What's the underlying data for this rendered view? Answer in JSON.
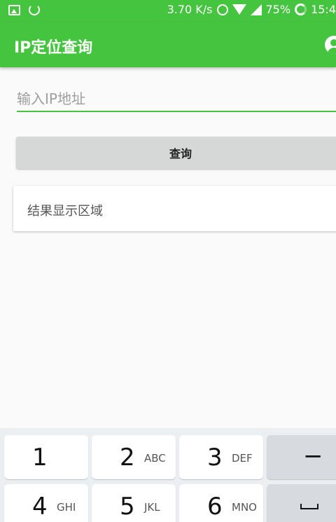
{
  "status_bar": {
    "speed": "3.70 K/s",
    "battery": "75%",
    "time": "15:4",
    "icons": [
      "image-icon",
      "swirl-icon",
      "alarm-icon",
      "wifi-icon",
      "signal-icon",
      "battery-icon"
    ]
  },
  "app_bar": {
    "title": "IP定位查询",
    "action_icon": "account-circle-icon"
  },
  "form": {
    "ip_placeholder": "输入IP地址",
    "ip_value": "",
    "query_label": "查询"
  },
  "result": {
    "text": "结果显示区域"
  },
  "keyboard": {
    "keys": [
      {
        "num": "1",
        "letters": ""
      },
      {
        "num": "2",
        "letters": "ABC"
      },
      {
        "num": "3",
        "letters": "DEF"
      },
      {
        "num": "4",
        "letters": "GHI"
      },
      {
        "num": "5",
        "letters": "JKL"
      },
      {
        "num": "6",
        "letters": "MNO"
      }
    ],
    "minus_label": "−"
  },
  "colors": {
    "primary": "#45c43f",
    "button_gray": "#d6d7d7",
    "background": "#fafafa"
  }
}
